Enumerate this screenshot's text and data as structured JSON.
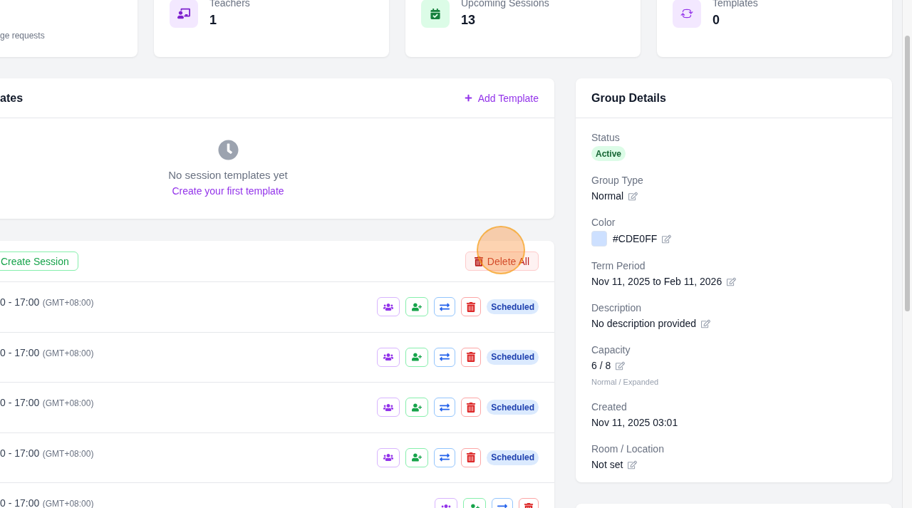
{
  "stat_cards": [
    {
      "kind": "requests",
      "note": "ge requests"
    },
    {
      "kind": "teachers",
      "label": "Teachers",
      "value": "1"
    },
    {
      "kind": "sessions",
      "label": "Upcoming Sessions",
      "value": "13"
    },
    {
      "kind": "templates",
      "label": "Templates",
      "value": "0"
    }
  ],
  "templates_card": {
    "title": "ates",
    "add_button": "Add Template",
    "empty_title": "No session templates yet",
    "empty_link": "Create your first template"
  },
  "sessions_card": {
    "create_button": "Create Session",
    "delete_all_button": "Delete All",
    "rows": [
      {
        "time": "0 - 17:00",
        "timezone": "(GMT+08:00)",
        "status": "Scheduled"
      },
      {
        "time": "0 - 17:00",
        "timezone": "(GMT+08:00)",
        "status": "Scheduled"
      },
      {
        "time": "0 - 17:00",
        "timezone": "(GMT+08:00)",
        "status": "Scheduled"
      },
      {
        "time": "0 - 17:00",
        "timezone": "(GMT+08:00)",
        "status": "Scheduled"
      },
      {
        "time": "0 - 17:00",
        "timezone": "(GMT+08:00)"
      }
    ]
  },
  "group_details": {
    "title": "Group Details",
    "fields": [
      {
        "label": "Status",
        "kind": "badge",
        "value": "Active"
      },
      {
        "label": "Group Type",
        "kind": "text",
        "value": "Normal",
        "editable": true
      },
      {
        "label": "Color",
        "kind": "color",
        "value": "#CDE0FF",
        "color": "#cde0ff",
        "editable": true
      },
      {
        "label": "Term Period",
        "kind": "text",
        "value": "Nov 11, 2025 to Feb 11, 2026",
        "editable": true
      },
      {
        "label": "Description",
        "kind": "text",
        "value": "No description provided",
        "editable": true
      },
      {
        "label": "Capacity",
        "kind": "text",
        "value": "6 / 8",
        "editable": true,
        "note": "Normal / Expanded"
      },
      {
        "label": "Created",
        "kind": "text",
        "value": "Nov 11, 2025 03:01",
        "editable": false
      },
      {
        "label": "Room / Location",
        "kind": "text",
        "value": "Not set",
        "editable": true
      }
    ]
  }
}
